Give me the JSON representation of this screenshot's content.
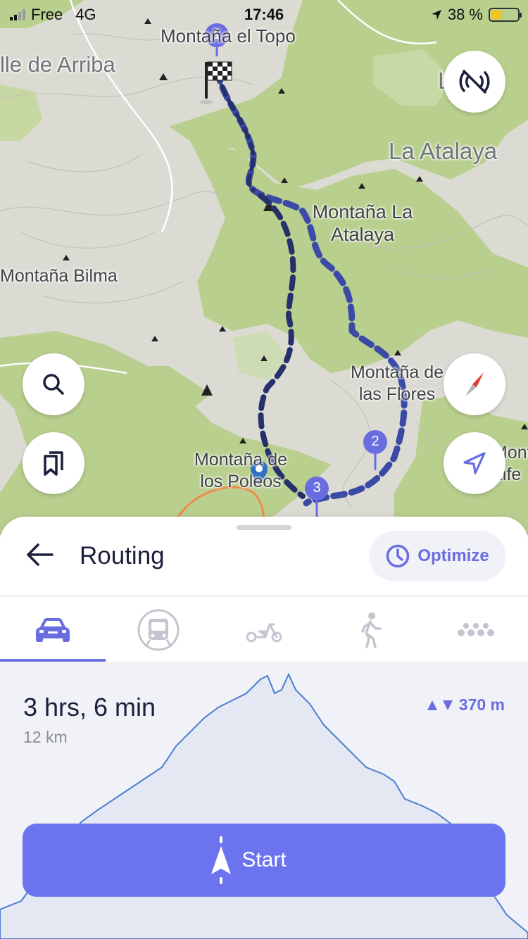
{
  "status_bar": {
    "carrier": "Free",
    "network": "4G",
    "time": "17:46",
    "battery": "38 %"
  },
  "map": {
    "labels": {
      "montana_el_topo": "Montaña el Topo",
      "valle_de_arriba": "lle de Arriba",
      "la_atalaya": "La Atalaya",
      "montana_la_atalaya": "Montaña La\nAtalaya",
      "montana_bilma": "Montaña Bilma",
      "montana_de_las_flores": "Montaña de\nlas Flores",
      "montana_de_los_poleos": "Montaña de\nlos Poleos",
      "montana_life": "Monta\nLife",
      "la_edge": "La"
    },
    "waypoints": {
      "wp1": "1",
      "wp2": "2",
      "wp3": "3"
    },
    "colors": {
      "route": "#26306a",
      "route_alt": "#3a4aa6",
      "pin": "#6a6de0",
      "green": "#b9cf8e"
    }
  },
  "controls": {
    "search_icon": "search-icon",
    "bookmarks_icon": "bookmarks-icon",
    "compass_icon": "compass-icon",
    "locate_icon": "location-arrow-icon",
    "no_signal_icon": "no-signal-icon"
  },
  "sheet": {
    "title": "Routing",
    "optimize_label": "Optimize",
    "tabs": [
      {
        "name": "car",
        "icon": "car-icon"
      },
      {
        "name": "transit",
        "icon": "bus-icon"
      },
      {
        "name": "scooter",
        "icon": "scooter-icon"
      },
      {
        "name": "walk",
        "icon": "walking-icon"
      },
      {
        "name": "more",
        "icon": "more-icon"
      }
    ],
    "selected_tab": "car",
    "duration": "3 hrs, 6 min",
    "distance": "12 km",
    "elevation": "370 m",
    "start_label": "Start",
    "accent": "#6a6de0"
  }
}
